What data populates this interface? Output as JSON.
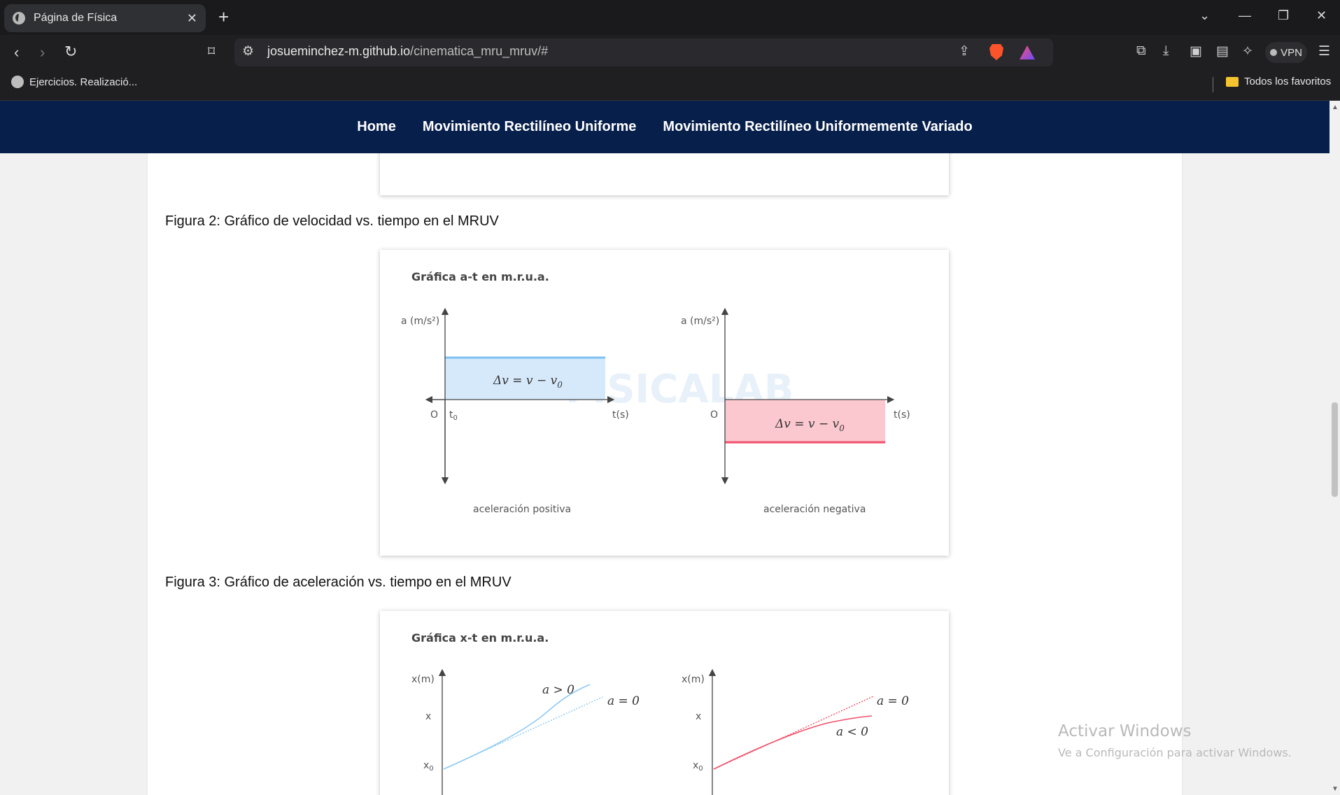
{
  "browser": {
    "tab_title": "Página de Física",
    "tab_close": "✕",
    "new_tab": "+",
    "url_host": "josueminchez-m.github.io",
    "url_path": "/cinematica_mru_mruv/#",
    "vpn_label": "VPN",
    "bookmarks": {
      "left_item": "Ejercicios. Realizació...",
      "right_item": "Todos los favoritos"
    }
  },
  "site_nav": {
    "items": [
      "Home",
      "Movimiento Rectilíneo Uniforme",
      "Movimiento Rectilíneo Uniformemente Variado"
    ]
  },
  "figures": {
    "fig2_caption": "Figura 2: Gráfico de velocidad vs. tiempo en el MRUV",
    "fig3_caption": "Figura 3: Gráfico de aceleración vs. tiempo en el MRUV"
  },
  "at_chart": {
    "title": "Gráfica a-t en m.r.u.a.",
    "left": {
      "ylabel": "a (m/s²)",
      "xlabel": "t(s)",
      "origin": "O",
      "t0": "t",
      "t0_sub": "0",
      "formula": "Δv = v − v",
      "formula_sub": "0",
      "caption": "aceleración positiva",
      "fill": "#d6e9fb",
      "stroke": "#7cc0f0"
    },
    "right": {
      "ylabel": "a (m/s²)",
      "xlabel": "t(s)",
      "origin": "O",
      "formula": "Δv = v − v",
      "formula_sub": "0",
      "caption": "aceleración negativa",
      "fill": "#fcc8cf",
      "stroke": "#f0506a"
    },
    "watermark": "FISICALAB"
  },
  "xt_chart": {
    "title": "Gráfica x-t en m.r.u.a.",
    "left": {
      "ylabel": "x(m)",
      "tick_x": "x",
      "tick_x0": "x",
      "tick_x0_sub": "0",
      "curve_label": "a > 0",
      "line_label": "a = 0",
      "color": "#8fcaf2"
    },
    "right": {
      "ylabel": "x(m)",
      "tick_x": "x",
      "tick_x0": "x",
      "tick_x0_sub": "0",
      "curve_label": "a < 0",
      "line_label": "a = 0",
      "color": "#f0506a"
    }
  },
  "windows_watermark": {
    "title": "Activar Windows",
    "subtitle": "Ve a Configuración para activar Windows."
  }
}
